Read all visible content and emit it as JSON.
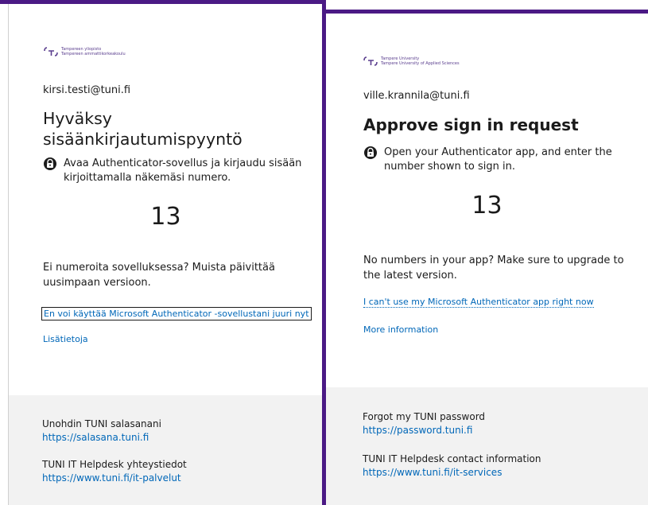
{
  "colors": {
    "frame": "#4b1a85",
    "link": "#0067b8",
    "footer_bg": "#f2f2f2",
    "text": "#1b1b1b",
    "logo": "#5a3e8e"
  },
  "left_panel": {
    "logo": {
      "icon": "tuni-logo-icon",
      "line1": "Tampereen yliopisto",
      "line2": "Tampereen ammattikorkeakoulu"
    },
    "email": "kirsi.testi@tuni.fi",
    "heading_line1": "Hyväksy",
    "heading_line2": "sisäänkirjautumispyyntö",
    "instruction_icon": "lock-icon",
    "instruction_line1": "Avaa Authenticator-sovellus ja kirjaudu sisään",
    "instruction_line2": "kirjoittamalla näkemäsi numero.",
    "number": "13",
    "note_line1": "Ei numeroita sovelluksessa? Muista päivittää",
    "note_line2": "uusimpaan versioon.",
    "cant_use_link": "En voi käyttää Microsoft Authenticator -sovellustani juuri nyt",
    "more_info_link": "Lisätietoja",
    "footer": {
      "password_label": "Unohdin TUNI salasanani",
      "password_url": "https://salasana.tuni.fi",
      "helpdesk_label": "TUNI IT Helpdesk yhteystiedot",
      "helpdesk_url": "https://www.tuni.fi/it-palvelut"
    }
  },
  "right_panel": {
    "logo": {
      "icon": "tuni-logo-icon",
      "line1": "Tampere University",
      "line2": "Tampere University of Applied Sciences"
    },
    "email": "ville.krannila@tuni.fi",
    "heading": "Approve sign in request",
    "instruction_icon": "lock-icon",
    "instruction_line1": "Open your Authenticator app, and enter the",
    "instruction_line2": "number shown to sign in.",
    "number": "13",
    "note_line1": "No numbers in your app? Make sure to upgrade to",
    "note_line2": "the latest version.",
    "cant_use_link": "I can't use my Microsoft Authenticator app right now",
    "more_info_link": "More information",
    "footer": {
      "password_label": "Forgot my TUNI password",
      "password_url": "https://password.tuni.fi",
      "helpdesk_label": "TUNI IT Helpdesk contact information",
      "helpdesk_url": "https://www.tuni.fi/it-services"
    }
  }
}
